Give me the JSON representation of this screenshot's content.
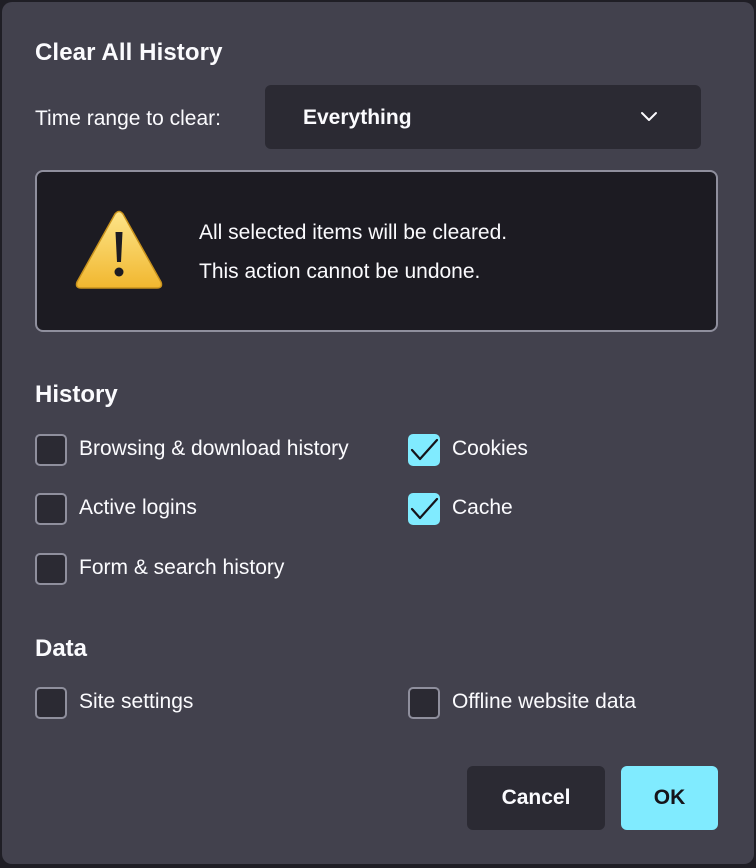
{
  "dialog": {
    "title": "Clear All History"
  },
  "time_range": {
    "label": "Time range to clear:",
    "selected": "Everything",
    "icon": "chevron-down-icon"
  },
  "warning": {
    "icon": "warning-triangle-icon",
    "line1": "All selected items will be cleared.",
    "line2": "This action cannot be undone."
  },
  "history": {
    "heading": "History",
    "items": [
      {
        "label": "Browsing & download history",
        "checked": false
      },
      {
        "label": "Cookies",
        "checked": true
      },
      {
        "label": "Active logins",
        "checked": false
      },
      {
        "label": "Cache",
        "checked": true
      },
      {
        "label": "Form & search history",
        "checked": false
      }
    ]
  },
  "data": {
    "heading": "Data",
    "items": [
      {
        "label": "Site settings",
        "checked": false
      },
      {
        "label": "Offline website data",
        "checked": false
      }
    ]
  },
  "buttons": {
    "cancel": "Cancel",
    "ok": "OK"
  },
  "colors": {
    "dialog_bg": "#42414d",
    "field_bg": "#2b2a33",
    "accent": "#80ebff",
    "warning_yellow": "#f6c343"
  }
}
